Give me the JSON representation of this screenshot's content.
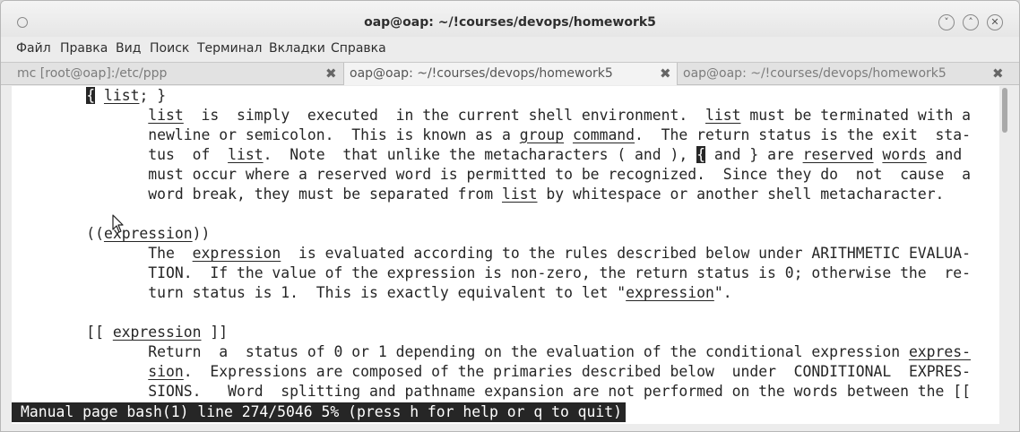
{
  "window": {
    "title": "oap@oap: ~/!courses/devops/homework5",
    "minimize_symbol": "˅",
    "maximize_symbol": "˄",
    "close_symbol": "✕"
  },
  "menu": [
    "Файл",
    "Правка",
    "Вид",
    "Поиск",
    "Терминал",
    "Вкладки",
    "Справка"
  ],
  "tabs": [
    {
      "label": "mc [root@oap]:/etc/ppp",
      "close": "✖"
    },
    {
      "label": "oap@oap: ~/!courses/devops/homework5",
      "close": "✖"
    },
    {
      "label": "oap@oap: ~/!courses/devops/homework5",
      "close": "✖"
    }
  ],
  "active_tab": 1,
  "terminal": {
    "lines": [
      [
        {
          "t": "      "
        },
        {
          "t": "{",
          "c": 1
        },
        {
          "t": " "
        },
        {
          "t": "list",
          "u": 1
        },
        {
          "t": "; }"
        }
      ],
      [
        {
          "t": "             "
        },
        {
          "t": "list",
          "u": 1
        },
        {
          "t": "  is  simply  executed  in the current shell environment.  "
        },
        {
          "t": "list",
          "u": 1
        },
        {
          "t": " must be terminated with a"
        }
      ],
      [
        {
          "t": "             newline or semicolon.  This is known as a "
        },
        {
          "t": "group",
          "u": 1
        },
        {
          "t": " "
        },
        {
          "t": "command",
          "u": 1
        },
        {
          "t": ".  The return status is the exit  sta-"
        }
      ],
      [
        {
          "t": "             tus  of  "
        },
        {
          "t": "list",
          "u": 1
        },
        {
          "t": ".  Note  that unlike the metacharacters ( and ), "
        },
        {
          "t": "{",
          "c": 1
        },
        {
          "t": " and } are "
        },
        {
          "t": "reserved",
          "u": 1
        },
        {
          "t": " "
        },
        {
          "t": "words",
          "u": 1
        },
        {
          "t": " and"
        }
      ],
      [
        {
          "t": "             must occur where a reserved word is permitted to be recognized.  Since they do  not  cause  a"
        }
      ],
      [
        {
          "t": "             word break, they must be separated from "
        },
        {
          "t": "list",
          "u": 1
        },
        {
          "t": " by whitespace or another shell metacharacter."
        }
      ],
      [
        {
          "t": ""
        }
      ],
      [
        {
          "t": "      (("
        },
        {
          "t": "expression",
          "u": 1
        },
        {
          "t": "))"
        }
      ],
      [
        {
          "t": "             The  "
        },
        {
          "t": "expression",
          "u": 1
        },
        {
          "t": "  is evaluated according to the rules described below under ARITHMETIC EVALUA-"
        }
      ],
      [
        {
          "t": "             TION.  If the value of the expression is non-zero, the return status is 0; otherwise the  re-"
        }
      ],
      [
        {
          "t": "             turn status is 1.  This is exactly equivalent to let \""
        },
        {
          "t": "expression",
          "u": 1
        },
        {
          "t": "\"."
        }
      ],
      [
        {
          "t": ""
        }
      ],
      [
        {
          "t": "      [[ "
        },
        {
          "t": "expression",
          "u": 1
        },
        {
          "t": " ]]"
        }
      ],
      [
        {
          "t": "             Return  a  status of 0 or 1 depending on the evaluation of the conditional expression "
        },
        {
          "t": "expres-",
          "u": 1
        }
      ],
      [
        {
          "t": "             "
        },
        {
          "t": "sion",
          "u": 1
        },
        {
          "t": ".  Expressions are composed of the primaries described below  under  CONDITIONAL  EXPRES-"
        }
      ],
      [
        {
          "t": "             SIONS.   Word  splitting and pathname expansion are not performed on the words between the [["
        }
      ]
    ],
    "status": "Manual page bash(1) line 274/5046 5% (press h for help or q to quit)"
  }
}
